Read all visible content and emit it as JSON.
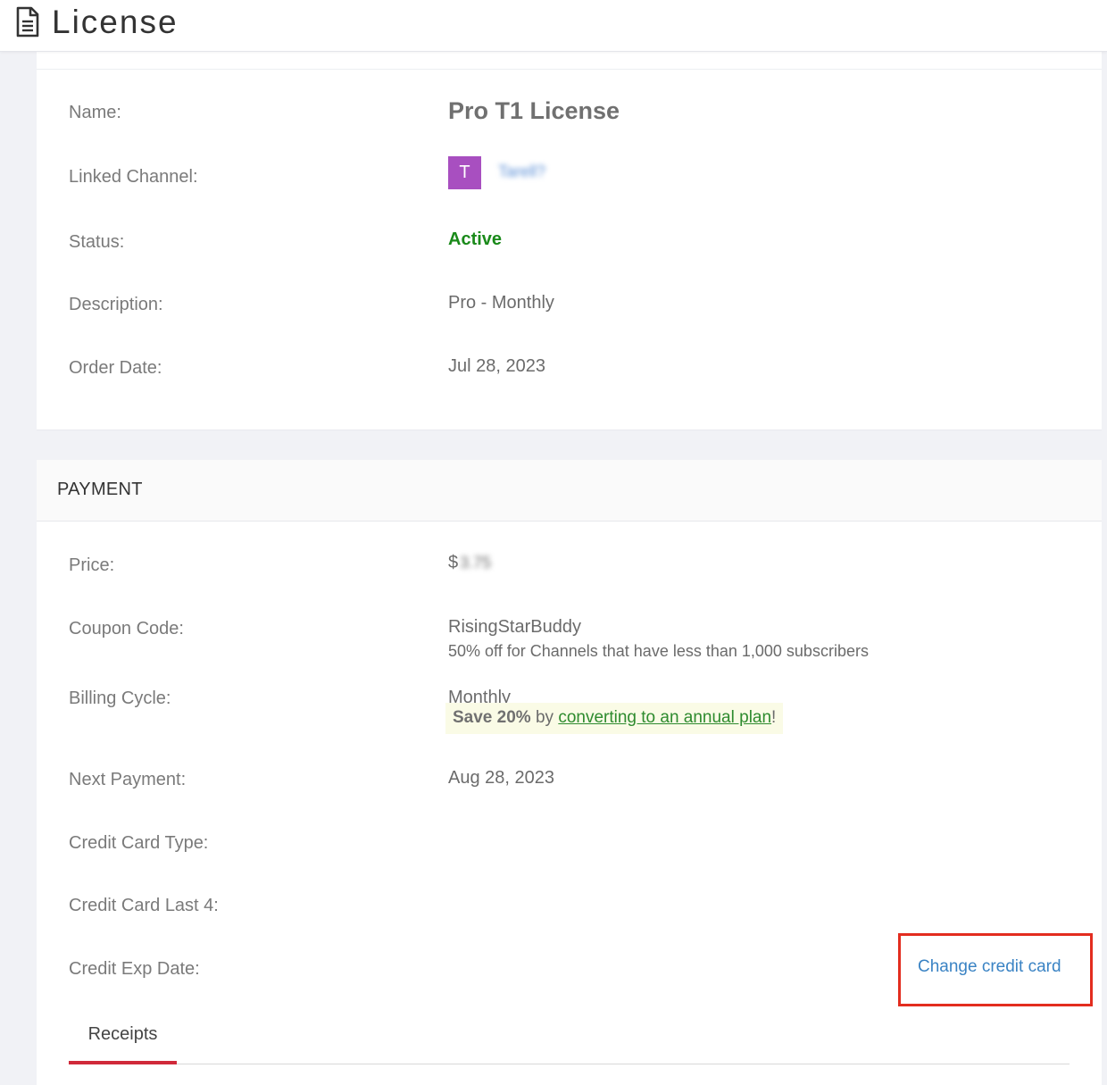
{
  "header": {
    "title": "License",
    "icon": "document-icon"
  },
  "license": {
    "name_label": "Name:",
    "name_value": "Pro T1 License",
    "channel_label": "Linked Channel:",
    "channel_avatar_letter": "T",
    "channel_avatar_color": "#a84fc0",
    "channel_name": "Tarell?",
    "status_label": "Status:",
    "status_value": "Active",
    "status_color": "#1a8a1a",
    "description_label": "Description:",
    "description_value": "Pro - Monthly",
    "order_date_label": "Order Date:",
    "order_date_value": "Jul 28, 2023"
  },
  "payment": {
    "heading": "PAYMENT",
    "price_label": "Price:",
    "price_currency": "$",
    "price_value": "3.75",
    "coupon_label": "Coupon Code:",
    "coupon_code": "RisingStarBuddy",
    "coupon_desc": "50% off for Channels that have less than 1,000 subscribers",
    "billing_label": "Billing Cycle:",
    "billing_value": "Monthly",
    "promo_bold": "Save 20%",
    "promo_by": " by ",
    "promo_link": "converting to an annual plan",
    "promo_end": "!",
    "next_payment_label": "Next Payment:",
    "next_payment_value": "Aug 28, 2023",
    "cc_type_label": "Credit Card Type:",
    "cc_last4_label": "Credit Card Last 4:",
    "cc_exp_label": "Credit Exp Date:",
    "change_cc_label": "Change credit card"
  },
  "tabs": {
    "receipts_label": "Receipts"
  }
}
